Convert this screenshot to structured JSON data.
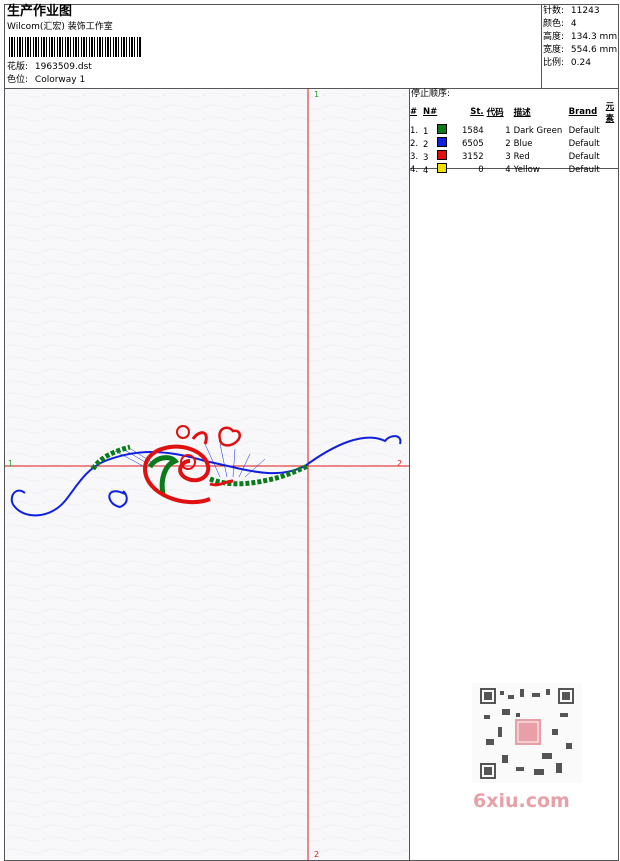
{
  "header": {
    "title": "生产作业图",
    "company": "Wilcom(汇宏) 装饰工作室",
    "design_label": "花版:",
    "design_value": "1963509.dst",
    "colorway_label": "色位:",
    "colorway_value": "Colorway 1"
  },
  "stats": {
    "stitches_label": "针数:",
    "stitches_value": "11243",
    "colors_label": "颜色:",
    "colors_value": "4",
    "height_label": "高度:",
    "height_value": "134.3 mm",
    "width_label": "宽度:",
    "width_value": "554.6 mm",
    "ratio_label": "比例:",
    "ratio_value": "0.24"
  },
  "stop_sequence": {
    "label": "停止顺序:",
    "columns": [
      "#",
      "N#",
      "St.",
      "代码",
      "描述",
      "Brand",
      "元素"
    ],
    "rows": [
      {
        "idx": "1.",
        "n": "1",
        "st": "1584",
        "code": "1",
        "desc": "Dark Green",
        "brand": "Default",
        "color": "#0a7a1a"
      },
      {
        "idx": "2.",
        "n": "2",
        "st": "6505",
        "code": "2",
        "desc": "Blue",
        "brand": "Default",
        "color": "#1020e0"
      },
      {
        "idx": "3.",
        "n": "3",
        "st": "3152",
        "code": "3",
        "desc": "Red",
        "brand": "Default",
        "color": "#e01010"
      },
      {
        "idx": "4.",
        "n": "4",
        "st": "0",
        "code": "4",
        "desc": "Yellow",
        "brand": "Default",
        "color": "#f0e000"
      }
    ]
  },
  "axes": {
    "top": "1",
    "bottom": "2",
    "left": "1",
    "right": "2"
  },
  "watermark": "6xiu.com"
}
